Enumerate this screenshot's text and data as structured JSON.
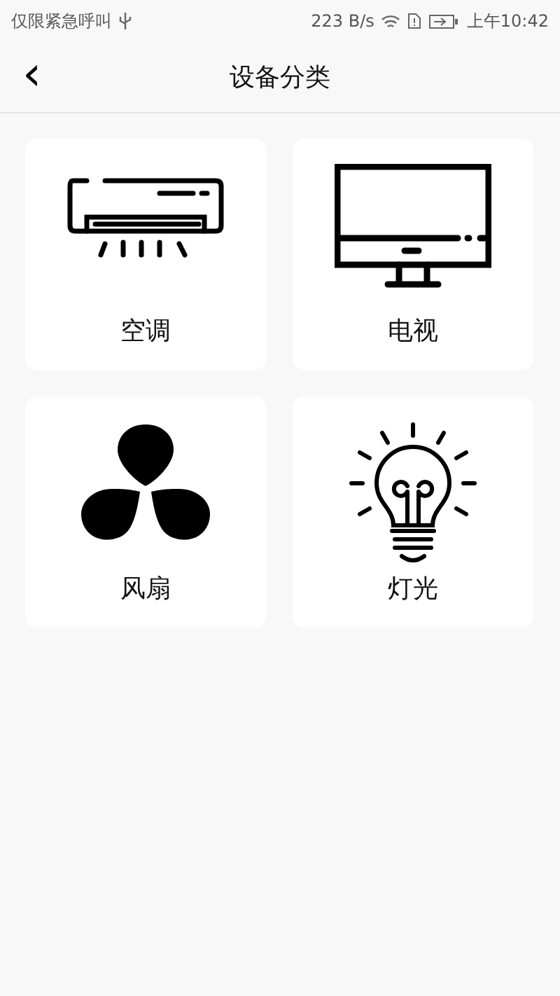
{
  "status_bar": {
    "carrier": "仅限紧急呼叫",
    "speed": "223 B/s",
    "time": "上午10:42"
  },
  "header": {
    "back": "‹",
    "title": "设备分类"
  },
  "categories": [
    {
      "kind": "ac",
      "label": "空调"
    },
    {
      "kind": "tv",
      "label": "电视"
    },
    {
      "kind": "fan",
      "label": "风扇"
    },
    {
      "kind": "bulb",
      "label": "灯光"
    }
  ]
}
